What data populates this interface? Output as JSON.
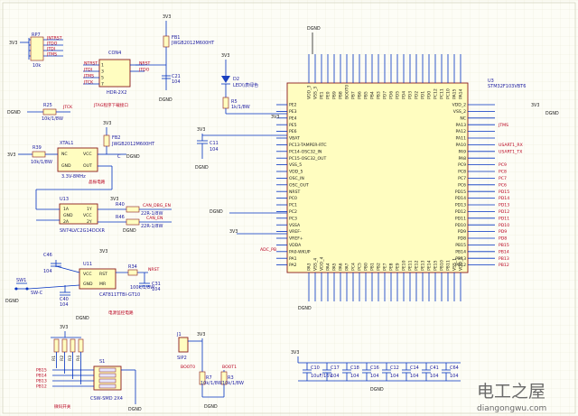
{
  "mcu": {
    "ref": "U3",
    "part": "STM32F103VBT6",
    "left_pins": [
      "PE2",
      "PE3",
      "PE4",
      "PE5",
      "PE6",
      "VBAT",
      "PC13-TAMPER-RTC",
      "PC14-OSC32_IN",
      "PC15-OSC32_OUT",
      "VSS_5",
      "VDD_5",
      "OSC_IN",
      "OSC_OUT",
      "NRST",
      "PC0",
      "PC1",
      "PC2",
      "PC3",
      "VSSA",
      "VREF-",
      "VREF+",
      "VDDA",
      "PA0-WKUP",
      "PA1",
      "PA2"
    ],
    "right_pins": [
      "VDD_2",
      "VSS_2",
      "NC",
      "PA13",
      "PA12",
      "PA11",
      "PA10",
      "PA9",
      "PA8",
      "PC9",
      "PC8",
      "PC7",
      "PC6",
      "PD15",
      "PD14",
      "PD13",
      "PD12",
      "PD11",
      "PD10",
      "PD9",
      "PD8",
      "PB15",
      "PB14",
      "PB13",
      "PB12"
    ],
    "top_pins": [
      "VDD_3",
      "VSS_3",
      "PE1",
      "PE0",
      "PB9",
      "PB8",
      "BOOT0",
      "PB7",
      "PB6",
      "PB5",
      "PB4",
      "PB3",
      "PD7",
      "PD6",
      "PD5",
      "PD4",
      "PD3",
      "PD2",
      "PD1",
      "PD0",
      "PC12",
      "PC11",
      "PC10",
      "PA15",
      "PA14"
    ],
    "bottom_pins": [
      "PA3",
      "VSS_4",
      "VDD_4",
      "PA4",
      "PA5",
      "PA6",
      "PA7",
      "PC4",
      "PC5",
      "PB0",
      "PB1",
      "PB2",
      "PE7",
      "PE8",
      "PE9",
      "PE10",
      "PE11",
      "PE12",
      "PE13",
      "PE14",
      "PE15",
      "PB10",
      "PB11",
      "VSS_1",
      "VDD_1"
    ],
    "right_nets": [
      "",
      "",
      "",
      "JTMS",
      "",
      "",
      "USART1_RX",
      "USART1_TX",
      "",
      "PC9",
      "PC8",
      "PC7",
      "PC6",
      "PD15",
      "PD14",
      "PD13",
      "PD12",
      "PD11",
      "PD10",
      "PD9",
      "PD8",
      "PB15",
      "PB14",
      "PB13",
      "PB12"
    ]
  },
  "jtag_resistors": {
    "ref": "RP7",
    "value": "10k",
    "nets": [
      "JNTRST",
      "JTDO",
      "JTDI",
      "JTMS"
    ]
  },
  "jtag_header": {
    "ref": "CON4",
    "part": "HDR-2X2",
    "left_nets": [
      "NTRST",
      "JTDI",
      "JTMS",
      "JTCK"
    ],
    "right_nets": [
      "NRST",
      "JTDO"
    ],
    "caption": "JTAG程序下载接口"
  },
  "ferrite_top": {
    "ref": "FB1",
    "part": "JWGB2012M600HT"
  },
  "cap_c21": {
    "ref": "C21",
    "value": "104"
  },
  "led": {
    "ref": "D2",
    "label": "LED\\\\表绿色"
  },
  "r5": {
    "ref": "R5",
    "value": "1k/1/8W"
  },
  "r25": {
    "ref": "R25",
    "value": "10k/1/8W",
    "net": "JTCK"
  },
  "xtal": {
    "ref": "XTAL1",
    "freq": "3.3V-8MHz",
    "caption": "晶振电路",
    "pins": [
      "NC",
      "VCC",
      "GND",
      "OUT"
    ]
  },
  "r39": {
    "ref": "R39",
    "value": "10k/1/8W"
  },
  "fb2": {
    "ref": "FB2",
    "part": "JWGB2012M600HT"
  },
  "c11": {
    "ref": "C11",
    "value": "104"
  },
  "u13": {
    "ref": "U13",
    "part": "SN74LVC2G14DCKR",
    "pins": [
      "1A",
      "1Y",
      "GND",
      "VCC",
      "2A",
      "2Y"
    ]
  },
  "r40": {
    "ref": "R40",
    "value": "22R-1/8W"
  },
  "r46": {
    "ref": "R46",
    "value": "22R-1/8W"
  },
  "can_nets": [
    "CAN_DBG_EN",
    "CAN_EN"
  ],
  "reset_ic": {
    "ref": "U11",
    "part": "CAT811TTBI-GT10",
    "pins": [
      "VCC",
      "RST",
      "GND",
      "MR"
    ],
    "caption": "电源监控电路"
  },
  "reset_parts": {
    "sw": "SW1",
    "sw_label": "SW-C",
    "c46": "C46",
    "c46_val": "104",
    "c40": "C40",
    "c40_val": "104",
    "r34": "R34",
    "r34_val": "100k/1/8W",
    "c31": "C31",
    "c31_val": "104",
    "nrst": "NRST"
  },
  "dip_switch": {
    "ref": "S1",
    "part": "CSW-SMD 2X4",
    "caption": "微码开关",
    "nets": [
      "PB15",
      "PB14",
      "PB13",
      "PB12"
    ],
    "resistors": [
      "R1",
      "R2",
      "R3",
      "R4"
    ]
  },
  "boot": {
    "jumper": "J1",
    "jumper_label": "SIP2",
    "boot0": "BOOT0",
    "boot1": "BOOT1",
    "r7": "R7",
    "r7_val": "10k/1/8W",
    "r3": "R3",
    "r3_val": "10k/1/8W"
  },
  "decoupling": [
    {
      "ref": "C10",
      "val": "10uF/16V"
    },
    {
      "ref": "C17",
      "val": "104"
    },
    {
      "ref": "C18",
      "val": "104"
    },
    {
      "ref": "C16",
      "val": "104"
    },
    {
      "ref": "C12",
      "val": "104"
    },
    {
      "ref": "C14",
      "val": "104"
    },
    {
      "ref": "C41",
      "val": "104"
    },
    {
      "ref": "C64",
      "val": "104"
    }
  ],
  "power_labels": {
    "v33": "3V3",
    "gnd": "DGND"
  },
  "adc_net": "ADC_PB",
  "watermark": {
    "main": "电工之屋",
    "url": "diangongwu.com"
  }
}
